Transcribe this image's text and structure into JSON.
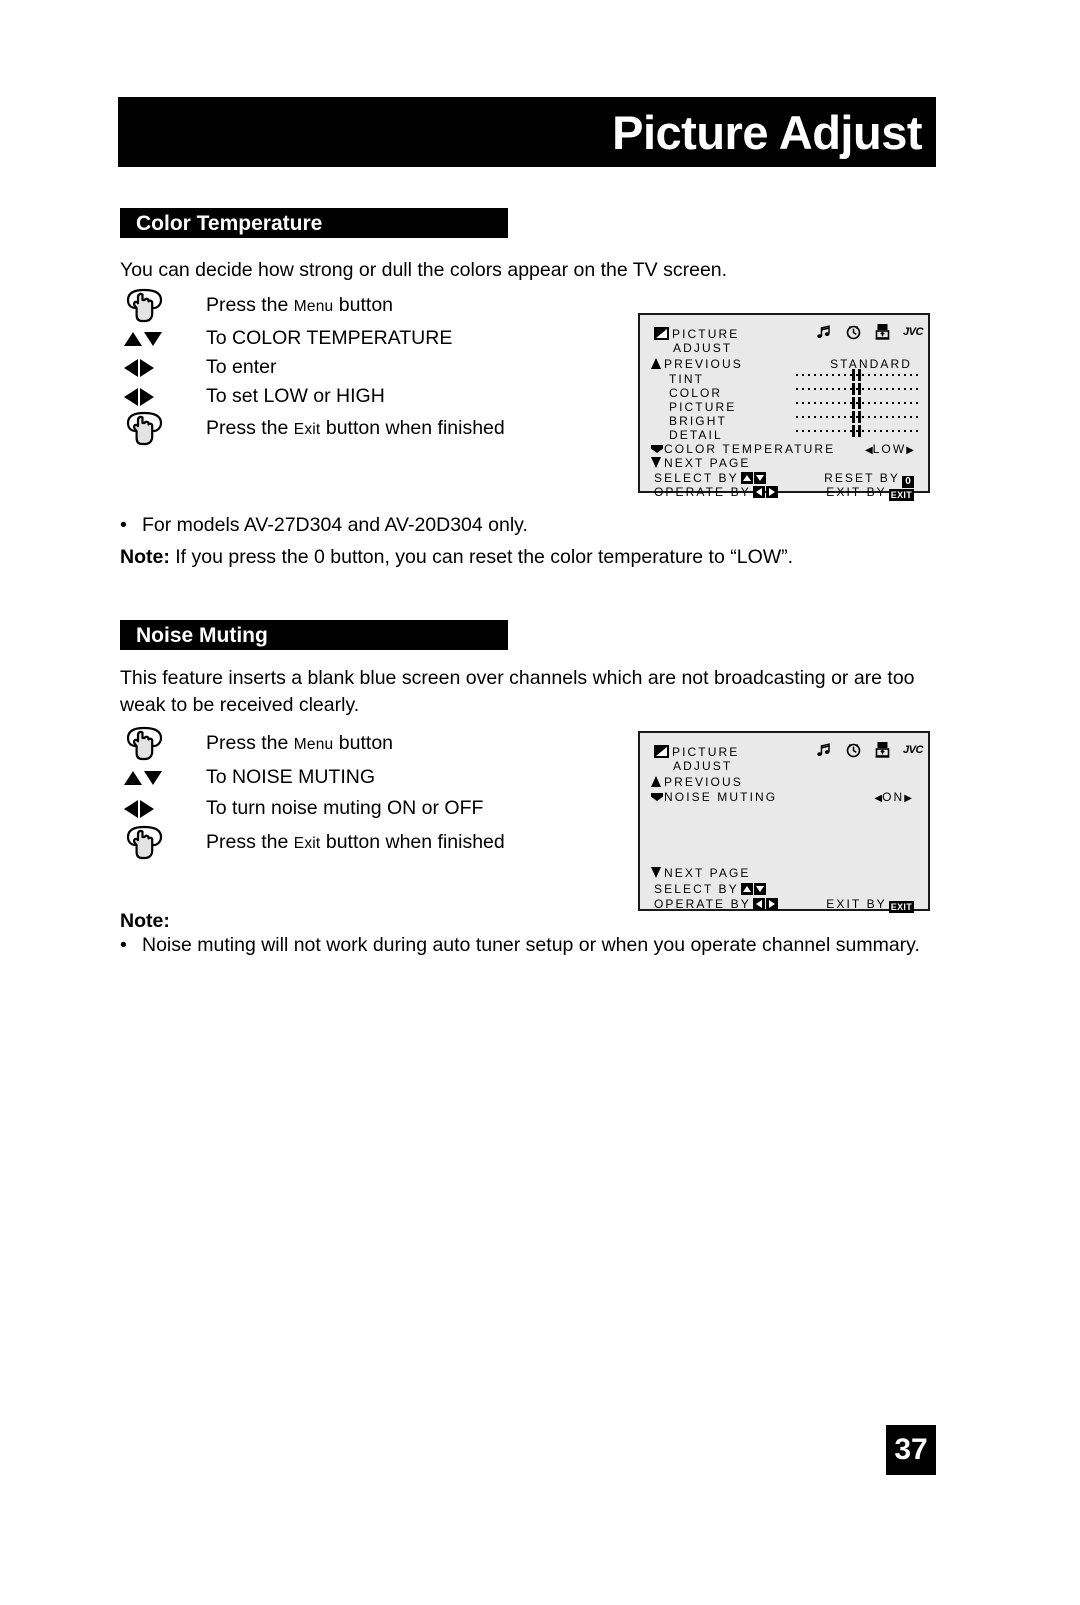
{
  "header": {
    "title": "Picture Adjust"
  },
  "page_number": "37",
  "sections": [
    {
      "heading": "Color Temperature",
      "intro": "You can decide how strong or dull the colors appear on the TV screen.",
      "steps": [
        {
          "icon": "hand-press-icon",
          "text_before": "Press the ",
          "smallcaps": "Menu",
          "text_after": " button"
        },
        {
          "icon": "up-down-arrows-icon",
          "text_before": "To COLOR TEMPERATURE",
          "smallcaps": "",
          "text_after": ""
        },
        {
          "icon": "left-right-arrows-icon",
          "text_before": "To enter",
          "smallcaps": "",
          "text_after": ""
        },
        {
          "icon": "left-right-arrows-icon",
          "text_before": "To set LOW or HIGH",
          "smallcaps": "",
          "text_after": ""
        },
        {
          "icon": "hand-press-icon",
          "text_before": "Press the ",
          "smallcaps": "Exit",
          "text_after": " button when finished"
        }
      ],
      "bullet": "For models AV-27D304 and AV-20D304 only.",
      "note_label": "Note:",
      "note_text": "If you press the 0 button, you can reset the color temperature to “LOW”."
    },
    {
      "heading": "Noise Muting",
      "intro": "This feature inserts a blank blue screen over channels which are not broadcasting or are too weak to be received clearly.",
      "steps": [
        {
          "icon": "hand-press-icon",
          "text_before": "Press the ",
          "smallcaps": "Menu",
          "text_after": " button"
        },
        {
          "icon": "up-down-arrows-icon",
          "text_before": "To NOISE MUTING",
          "smallcaps": "",
          "text_after": ""
        },
        {
          "icon": "left-right-arrows-icon",
          "text_before": "To turn noise muting ON or OFF",
          "smallcaps": "",
          "text_after": ""
        },
        {
          "icon": "hand-press-icon",
          "text_before": "Press the ",
          "smallcaps": "Exit",
          "text_after": " button when finished"
        }
      ],
      "note_label": "Note:",
      "note_bullet": "Noise muting will not work during auto tuner setup or when you operate channel summary."
    }
  ],
  "osd_color_temperature": {
    "title_line1": "PICTURE",
    "title_line2": "ADJUST",
    "previous": "PREVIOUS",
    "preset_value": "STANDARD",
    "items": [
      {
        "label": "TINT",
        "type": "slider"
      },
      {
        "label": "COLOR",
        "type": "slider"
      },
      {
        "label": "PICTURE",
        "type": "slider"
      },
      {
        "label": "BRIGHT",
        "type": "slider"
      },
      {
        "label": "DETAIL",
        "type": "slider"
      }
    ],
    "selected_item": "COLOR TEMPERATURE",
    "selected_value": "LOW",
    "next_page": "NEXT PAGE",
    "select_label": "SELECT   BY",
    "reset_label": "RESET BY",
    "reset_key": "0",
    "operate_label": "OPERATE BY",
    "exit_label": "EXIT BY",
    "exit_key": "EXIT",
    "brand": "JVC",
    "icons": [
      "music-note-icon",
      "clock-icon",
      "install-icon"
    ]
  },
  "osd_noise_muting": {
    "title_line1": "PICTURE",
    "title_line2": "ADJUST",
    "previous": "PREVIOUS",
    "selected_item": "NOISE MUTING",
    "selected_value": "ON",
    "next_page": "NEXT PAGE",
    "select_label": "SELECT   BY",
    "operate_label": "OPERATE BY",
    "exit_label": "EXIT BY",
    "exit_key": "EXIT",
    "brand": "JVC",
    "icons": [
      "music-note-icon",
      "clock-icon",
      "install-icon"
    ]
  }
}
